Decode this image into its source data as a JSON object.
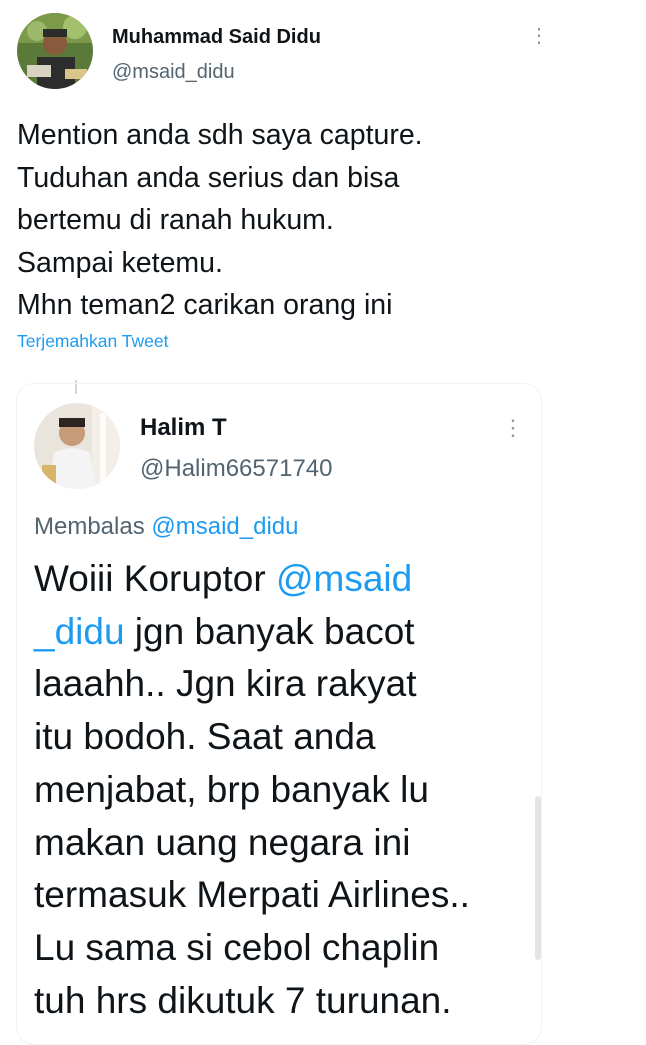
{
  "tweet": {
    "author_name": "Muhammad Said Didu",
    "author_handle": "@msaid_didu",
    "text_lines": [
      "Mention anda sdh saya capture.",
      "Tuduhan anda serius dan bisa",
      "bertemu di ranah hukum.",
      "Sampai ketemu.",
      "Mhn teman2 carikan orang ini"
    ],
    "translate_label": "Terjemahkan Tweet",
    "more_icon": "more-vertical-icon"
  },
  "quoted_tweet": {
    "author_name": "Halim T",
    "author_handle": "@Halim66571740",
    "reply_prefix": "Membalas",
    "reply_mention": "@msaid_didu",
    "line1_text": "Woiii Koruptor ",
    "line1_mention": "@msaid",
    "line2_mention": "_didu",
    "line2_text": " jgn banyak bacot",
    "text_lines": [
      "laaahh.. Jgn kira rakyat",
      "itu bodoh. Saat anda",
      "menjabat, brp banyak lu",
      "makan uang negara ini",
      "termasuk Merpati Airlines..",
      "Lu sama si cebol chaplin",
      "tuh hrs dikutuk 7 turunan."
    ],
    "more_icon": "more-vertical-icon"
  },
  "colors": {
    "link": "#1d9bf0",
    "secondary_text": "#536471",
    "primary_text": "#0f1419"
  }
}
